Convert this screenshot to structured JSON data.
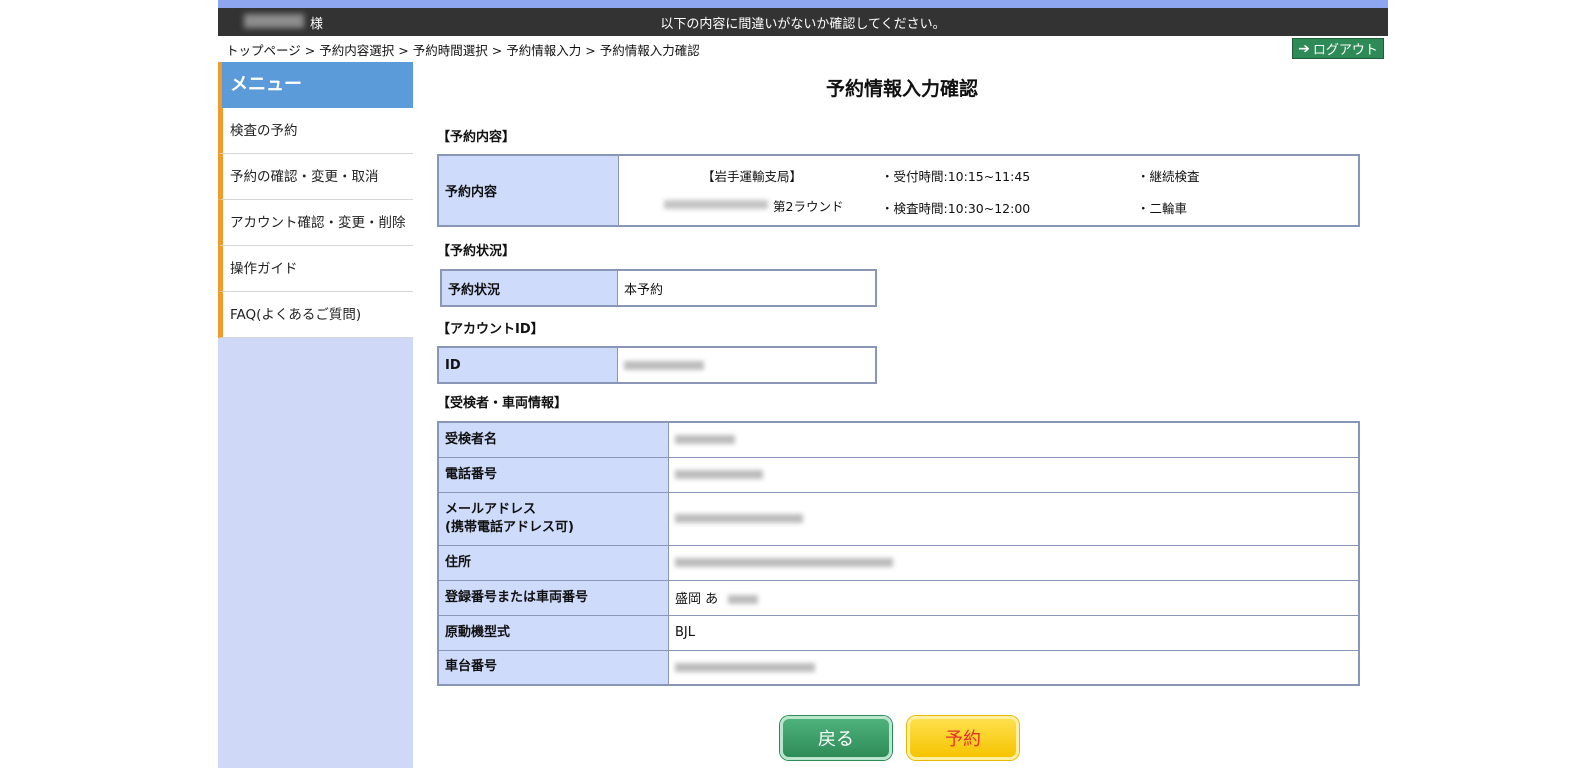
{
  "topbar": {
    "honorific": "様",
    "message": "以下の内容に間違いがないか確認してください。"
  },
  "breadcrumb": [
    "トップページ",
    "予約内容選択",
    "予約時間選択",
    "予約情報入力",
    "予約情報入力確認"
  ],
  "breadcrumb_separator": ">",
  "logout": {
    "icon": "arrow-right-icon",
    "arrow": "➔",
    "label": "ログアウト"
  },
  "sidebar": {
    "title": "メニュー",
    "items": [
      {
        "label": "検査の予約"
      },
      {
        "label": "予約の確認・変更・取消"
      },
      {
        "label": "アカウント確認・変更・削除"
      },
      {
        "label": "操作ガイド"
      },
      {
        "label": "FAQ(よくあるご質問)"
      }
    ]
  },
  "page_title": "予約情報入力確認",
  "sections": {
    "content": "【予約内容】",
    "status": "【予約状況】",
    "account": "【アカウントID】",
    "person": "【受検者・車両情報】"
  },
  "content_table": {
    "header": "予約内容",
    "office": "【岩手運輸支局】",
    "round": "第2ラウンド",
    "reception_time": "・受付時間:10:15~11:45",
    "inspection_time": "・検査時間:10:30~12:00",
    "inspection_type": "・継続検査",
    "vehicle_type": "・二輪車"
  },
  "status_table": {
    "header": "予約状況",
    "value": "本予約"
  },
  "account_table": {
    "header": "ID"
  },
  "person_table": {
    "rows": [
      {
        "label": "受検者名",
        "label2": ""
      },
      {
        "label": "電話番号",
        "label2": ""
      },
      {
        "label": "メールアドレス",
        "label2": "(携帯電話アドレス可)"
      },
      {
        "label": "住所",
        "label2": ""
      },
      {
        "label": "登録番号または車両番号",
        "label2": "",
        "value": "盛岡 あ"
      },
      {
        "label": "原動機型式",
        "label2": "",
        "value": "BJL"
      },
      {
        "label": "車台番号",
        "label2": ""
      }
    ]
  },
  "buttons": {
    "back": "戻る",
    "reserve": "予約"
  },
  "colors": {
    "topbar_bg": "#333333",
    "topbar_accent": "#8ea6f0",
    "menu_header": "#5b9bd9",
    "menu_accent": "#f19b2c",
    "table_header": "#cfdbfb",
    "back_button": "#2e8b57",
    "reserve_button": "#f5c400"
  }
}
